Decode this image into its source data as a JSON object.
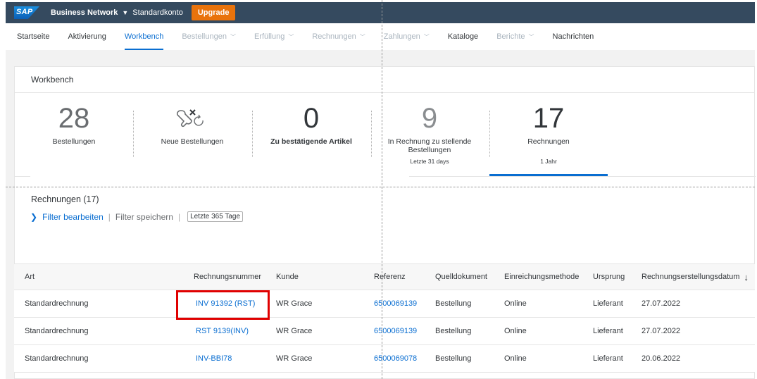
{
  "topbar": {
    "logo": "SAP",
    "brand": "Business Network",
    "account": "Standardkonto",
    "upgrade": "Upgrade"
  },
  "nav": {
    "items": [
      {
        "label": "Startseite",
        "state": "normal",
        "dropdown": false
      },
      {
        "label": "Aktivierung",
        "state": "normal",
        "dropdown": false
      },
      {
        "label": "Workbench",
        "state": "active",
        "dropdown": false
      },
      {
        "label": "Bestellungen",
        "state": "disabled",
        "dropdown": true
      },
      {
        "label": "Erfüllung",
        "state": "disabled",
        "dropdown": true
      },
      {
        "label": "Rechnungen",
        "state": "disabled",
        "dropdown": true
      },
      {
        "label": "Zahlungen",
        "state": "disabled",
        "dropdown": true
      },
      {
        "label": "Kataloge",
        "state": "normal",
        "dropdown": false
      },
      {
        "label": "Berichte",
        "state": "disabled",
        "dropdown": true
      },
      {
        "label": "Nachrichten",
        "state": "normal",
        "dropdown": false
      }
    ]
  },
  "workbench": {
    "title": "Workbench",
    "tiles": [
      {
        "value": "28",
        "label": "Bestellungen",
        "sub": ""
      },
      {
        "value": "",
        "label": "Neue Bestellungen",
        "sub": ""
      },
      {
        "value": "0",
        "label": "Zu bestätigende Artikel",
        "sub": ""
      },
      {
        "value": "9",
        "label": "In Rechnung zu stellende Bestellungen",
        "sub": "Letzte 31 days"
      },
      {
        "value": "17",
        "label": "Rechnungen",
        "sub": "1 Jahr"
      }
    ],
    "section_title": "Rechnungen (17)",
    "filter_edit": "Filter bearbeiten",
    "filter_save": "Filter speichern",
    "filter_badge": "Letzte 365 Tage"
  },
  "table": {
    "headers": [
      "Art",
      "Rechnungsnummer",
      "Kunde",
      "Referenz",
      "Quelldokument",
      "Einreichungsmethode",
      "Ursprung",
      "Rechnungserstellungsdatum"
    ],
    "rows": [
      [
        "Standardrechnung",
        "INV 91392 (RST)",
        "WR Grace",
        "6500069139",
        "Bestellung",
        "Online",
        "Lieferant",
        "27.07.2022"
      ],
      [
        "Standardrechnung",
        "RST 9139(INV)",
        "WR Grace",
        "6500069139",
        "Bestellung",
        "Online",
        "Lieferant",
        "27.07.2022"
      ],
      [
        "Standardrechnung",
        "INV-BBI78",
        "WR Grace",
        "6500069078",
        "Bestellung",
        "Online",
        "Lieferant",
        "20.06.2022"
      ]
    ]
  },
  "colors": {
    "shell": "#354a5f",
    "accent": "#0a6ed1",
    "upgrade": "#e9730c",
    "highlight": "#e00000"
  }
}
